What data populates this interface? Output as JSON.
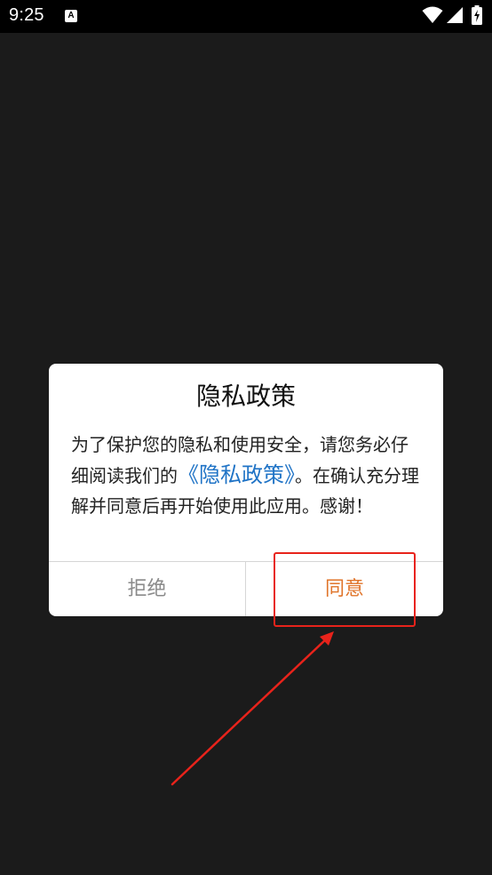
{
  "status_bar": {
    "time": "9:25",
    "notification_icon_letter": "A"
  },
  "dialog": {
    "title": "隐私政策",
    "body_before_link": "为了保护您的隐私和使用安全，请您务必仔细阅读我们的",
    "link_text": "《隐私政策》",
    "body_after_link": "。在确认充分理解并同意后再开始使用此应用。感谢！",
    "refuse_label": "拒绝",
    "agree_label": "同意",
    "link_color": "#1f73c6",
    "agree_color": "#e0742a",
    "refuse_color": "#8a8a8a"
  },
  "annotation": {
    "highlight_color": "#e8231b",
    "icon": "arrow-icon"
  }
}
